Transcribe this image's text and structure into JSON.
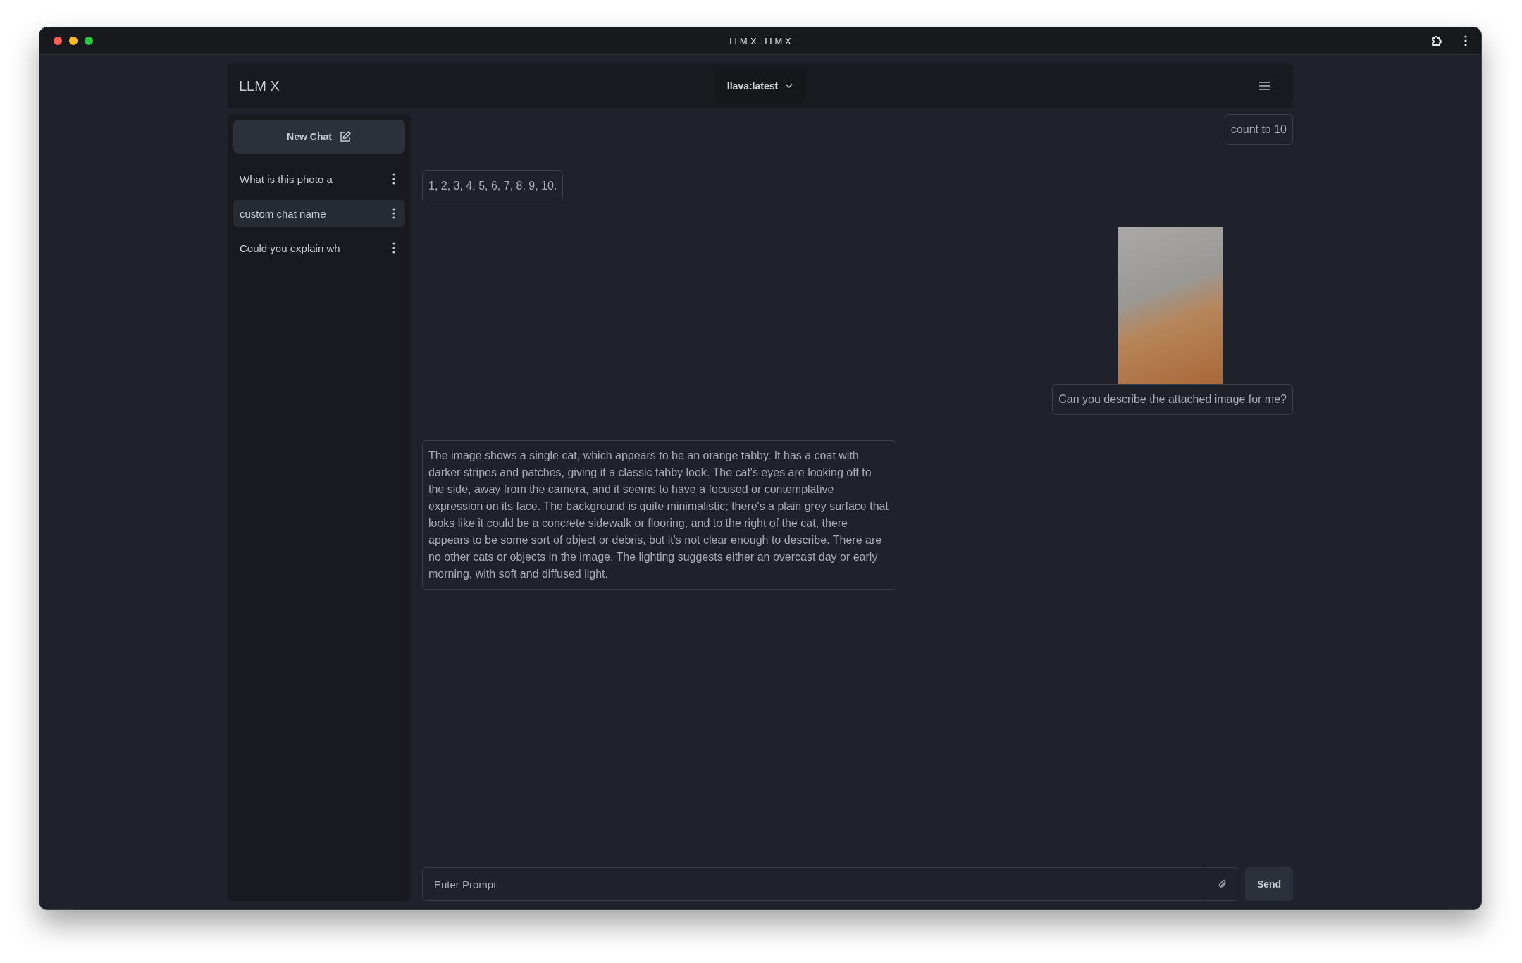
{
  "window": {
    "title": "LLM-X - LLM X"
  },
  "header": {
    "logo": "LLM X",
    "model_selector": {
      "label": "llava:latest"
    }
  },
  "sidebar": {
    "new_chat_button": {
      "label": "New Chat"
    },
    "chats": [
      {
        "title": "What is this photo a",
        "selected": false
      },
      {
        "title": "custom chat name",
        "selected": true
      },
      {
        "title": "Could you explain wh",
        "selected": false
      }
    ]
  },
  "messages": [
    {
      "kind": "user",
      "text": "count to 10"
    },
    {
      "kind": "assistant",
      "text": "1, 2, 3, 4, 5, 6, 7, 8, 9, 10."
    },
    {
      "kind": "user",
      "attachments": [
        {
          "kind": "image"
        }
      ],
      "text": "Can you describe the attached image for me?"
    },
    {
      "kind": "assistant",
      "text": "The image shows a single cat, which appears to be an orange tabby. It has a coat with darker stripes and patches, giving it a classic tabby look. The cat's eyes are looking off to the side, away from the camera, and it seems to have a focused or contemplative expression on its face. The background is quite minimalistic; there's a plain grey surface that looks like it could be a concrete sidewalk or flooring, and to the right of the cat, there appears to be some sort of object or debris, but it's not clear enough to describe. There are no other cats or objects in the image. The lighting suggests either an overcast day or early morning, with soft and diffused light."
    }
  ],
  "prompt": {
    "placeholder": "Enter Prompt"
  },
  "send_button": {
    "label": "Send"
  }
}
